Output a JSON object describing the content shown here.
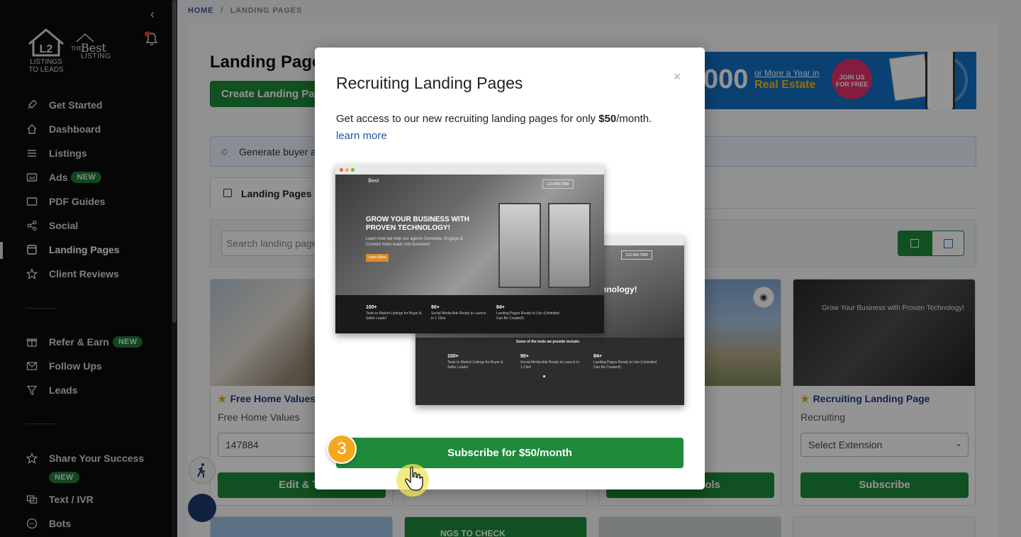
{
  "sidebar": {
    "logo1_text": "LISTINGS TO LEADS",
    "logo2_small": "THE",
    "logo2_brand": "Best",
    "logo2_sub": "LISTING",
    "items": [
      {
        "label": "Get Started",
        "icon": "rocket-icon"
      },
      {
        "label": "Dashboard",
        "icon": "home-icon"
      },
      {
        "label": "Listings",
        "icon": "list-icon"
      },
      {
        "label": "Ads",
        "icon": "ad-icon",
        "badge": "NEW"
      },
      {
        "label": "PDF Guides",
        "icon": "pdf-icon"
      },
      {
        "label": "Social",
        "icon": "share-icon"
      },
      {
        "label": "Landing Pages",
        "icon": "browser-icon",
        "active": true
      },
      {
        "label": "Client Reviews",
        "icon": "star-icon"
      },
      {
        "label": "Refer & Earn",
        "icon": "gift-icon",
        "badge": "NEW"
      },
      {
        "label": "Follow Ups",
        "icon": "mail-icon"
      },
      {
        "label": "Leads",
        "icon": "filter-icon"
      },
      {
        "label": "Share Your Success",
        "icon": "star-icon",
        "badge": "NEW"
      },
      {
        "label": "Text / IVR",
        "icon": "chat-icon"
      },
      {
        "label": "Bots",
        "icon": "bot-icon"
      }
    ]
  },
  "breadcrumb": {
    "home": "HOME",
    "separator": "/",
    "current": "LANDING PAGES"
  },
  "page": {
    "title": "Landing Pages",
    "create_button": "Create Landing Pag",
    "banner": {
      "amount": "000",
      "line1": "or More a Year in",
      "line2": "Real Estate",
      "join": "JOIN US",
      "join2": "FOR FREE"
    },
    "info_text": "Generate buyer a",
    "tab": "Landing Pages",
    "search_placeholder": "Search landing page"
  },
  "cards": [
    {
      "name": "Free Home Values",
      "sub": "Free Home Values",
      "field": "147884",
      "button": "Edit & To"
    },
    {
      "name": "",
      "sub": "",
      "field": "",
      "button": "ools"
    },
    {
      "name": "Recruiting Landing Page",
      "sub": "Recruiting",
      "field": "Select Extension",
      "button": "Subscribe",
      "preview_heading": "Grow Your Business with Proven Technology!"
    }
  ],
  "bottom_cards": {
    "card2_text": "NGS TO CHECK"
  },
  "modal": {
    "title": "Recruiting Landing Pages",
    "close": "×",
    "desc_before": "Get access to our new recruiting landing pages for only ",
    "price": "$50",
    "desc_after": "/month.",
    "learn_more": "learn more",
    "preview1": {
      "logo": "Best",
      "phone": "123-456-7890",
      "heading": "GROW YOUR BUSINESS WITH PROVEN TECHNOLOGY!",
      "body": "Learn how we help our agents Generate, Engage & Convert more leads into business!",
      "cta": "Learn More",
      "stats": [
        {
          "num": "100+",
          "text": "Tools to Market Listings for Buyer & Seller Leads!"
        },
        {
          "num": "90+",
          "text": "Social Media Ads Ready to Launch in 1 Click"
        },
        {
          "num": "84+",
          "text": "Landing Pages Ready to Use (Unlimited Can Be Created!)"
        }
      ]
    },
    "preview2": {
      "phone": "123-456-7890",
      "heading": "hnology!",
      "tools_text": "Some of the tools we provide include:",
      "stats": [
        {
          "num": "100+",
          "text": "Tools to Market Listings for Buyer & Seller Leads!"
        },
        {
          "num": "90+",
          "text": "Social Media Ads Ready to Launch in 1 Click"
        },
        {
          "num": "84+",
          "text": "Landing Pages Ready to Use (Unlimited Can Be Created!)"
        }
      ]
    },
    "subscribe_button": "Subscribe for $50/month",
    "step_number": "3"
  },
  "colors": {
    "green": "#1e8a3a",
    "accent_orange": "#f5a81e",
    "link_blue": "#1a56a8"
  }
}
